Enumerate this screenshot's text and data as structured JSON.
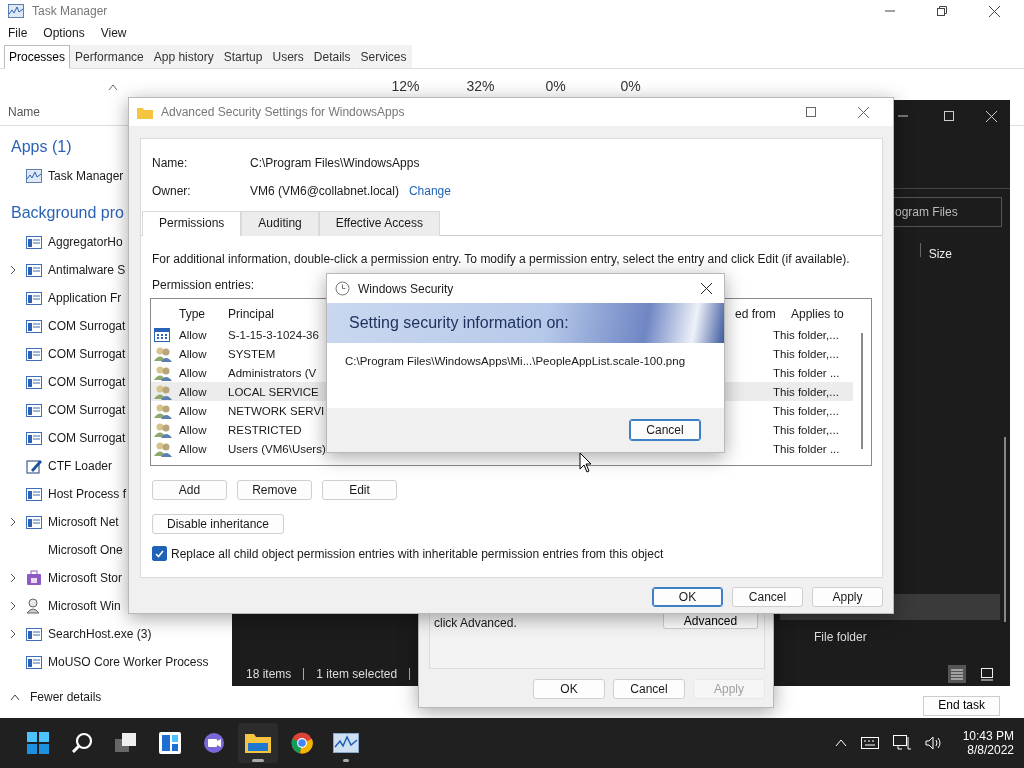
{
  "task_manager": {
    "title": "Task Manager",
    "menu": [
      "File",
      "Options",
      "View"
    ],
    "tabs": [
      {
        "label": "Processes",
        "selected": true
      },
      {
        "label": "Performance",
        "selected": false
      },
      {
        "label": "App history",
        "selected": false
      },
      {
        "label": "Startup",
        "selected": false
      },
      {
        "label": "Users",
        "selected": false
      },
      {
        "label": "Details",
        "selected": false
      },
      {
        "label": "Services",
        "selected": false
      }
    ],
    "usage": [
      "12%",
      "32%",
      "0%",
      "0%"
    ],
    "name_header": "Name",
    "groups": [
      {
        "label": "Apps (1)",
        "items": [
          {
            "name": "Task Manager",
            "kind": "chart",
            "expandable": false
          }
        ]
      },
      {
        "label": "Background pro",
        "items": [
          {
            "name": "AggregatorHo",
            "kind": "app",
            "expandable": false
          },
          {
            "name": "Antimalware S",
            "kind": "app",
            "expandable": true
          },
          {
            "name": "Application Fr",
            "kind": "app",
            "expandable": false
          },
          {
            "name": "COM Surrogat",
            "kind": "app",
            "expandable": false
          },
          {
            "name": "COM Surrogat",
            "kind": "app",
            "expandable": false
          },
          {
            "name": "COM Surrogat",
            "kind": "app",
            "expandable": false
          },
          {
            "name": "COM Surrogat",
            "kind": "app",
            "expandable": false
          },
          {
            "name": "COM Surrogat",
            "kind": "app",
            "expandable": false
          },
          {
            "name": "CTF Loader",
            "kind": "pen",
            "expandable": false
          },
          {
            "name": "Host Process f",
            "kind": "app",
            "expandable": false
          },
          {
            "name": "Microsoft Net",
            "kind": "app",
            "expandable": true
          },
          {
            "name": "Microsoft One",
            "kind": "blank",
            "expandable": false
          },
          {
            "name": "Microsoft Stor",
            "kind": "store",
            "expandable": true
          },
          {
            "name": "Microsoft Win",
            "kind": "person",
            "expandable": true
          },
          {
            "name": "SearchHost.exe (3)",
            "kind": "app",
            "expandable": true
          },
          {
            "name": "MoUSO Core Worker Process",
            "kind": "app",
            "expandable": false
          }
        ]
      }
    ],
    "fewer_details": "Fewer details",
    "end_task": "End task"
  },
  "explorer": {
    "search_text": "ogram Files",
    "size_header": "Size",
    "rows": [
      {
        "selected": true
      },
      {
        "type": "File folder",
        "selected": false
      }
    ],
    "status": [
      "18 items",
      "1 item selected"
    ],
    "views": [
      {
        "kind": "details",
        "selected": true
      },
      {
        "kind": "tiles",
        "selected": false
      }
    ]
  },
  "properties": {
    "text": "click Advanced.",
    "advanced": "Advanced",
    "buttons": [
      {
        "label": "OK",
        "disabled": false
      },
      {
        "label": "Cancel",
        "disabled": false
      },
      {
        "label": "Apply",
        "disabled": true
      }
    ]
  },
  "advanced_security": {
    "title": "Advanced Security Settings for WindowsApps",
    "name_label": "Name:",
    "name_value": "C:\\Program Files\\WindowsApps",
    "owner_label": "Owner:",
    "owner_value": "VM6 (VM6@collabnet.local)",
    "change_link": "Change",
    "tabs": [
      {
        "label": "Permissions",
        "selected": true
      },
      {
        "label": "Auditing",
        "selected": false
      },
      {
        "label": "Effective Access",
        "selected": false
      }
    ],
    "info": "For additional information, double-click a permission entry. To modify a permission entry, select the entry and click Edit (if available).",
    "entries_label": "Permission entries:",
    "columns": [
      "Type",
      "Principal",
      "ed from",
      "Applies to"
    ],
    "entries": [
      {
        "kind": "app",
        "type": "Allow",
        "principal": "S-1-15-3-1024-36",
        "applies_to": "This folder,...",
        "selected": false
      },
      {
        "kind": "group",
        "type": "Allow",
        "principal": "SYSTEM",
        "applies_to": "This folder,...",
        "selected": false
      },
      {
        "kind": "group",
        "type": "Allow",
        "principal": "Administrators (V",
        "applies_to": "This folder ...",
        "selected": false
      },
      {
        "kind": "group",
        "type": "Allow",
        "principal": "LOCAL SERVICE",
        "applies_to": "This folder,...",
        "selected": true
      },
      {
        "kind": "group",
        "type": "Allow",
        "principal": "NETWORK SERVI",
        "applies_to": "This folder,...",
        "selected": false
      },
      {
        "kind": "group",
        "type": "Allow",
        "principal": "RESTRICTED",
        "applies_to": "This folder,...",
        "selected": false
      },
      {
        "kind": "group",
        "type": "Allow",
        "principal": "Users (VM6\\Users)",
        "applies_to": "This folder ...",
        "selected": false
      }
    ],
    "entry_buttons": [
      "Add",
      "Remove",
      "Edit"
    ],
    "disable_inheritance": "Disable inheritance",
    "replace_option": {
      "label": "Replace all child object permission entries with inheritable permission entries from this object",
      "checked": true
    },
    "footer_buttons": [
      {
        "label": "OK",
        "default": true
      },
      {
        "label": "Cancel",
        "default": false
      },
      {
        "label": "Apply",
        "default": false
      }
    ]
  },
  "windows_security": {
    "title": "Windows Security",
    "heading": "Setting security information on:",
    "path": "C:\\Program Files\\WindowsApps\\Mi...\\PeopleAppList.scale-100.png",
    "cancel": "Cancel"
  },
  "taskbar": {
    "apps": [
      {
        "kind": "start",
        "running": false,
        "active": false
      },
      {
        "kind": "search",
        "running": false,
        "active": false
      },
      {
        "kind": "taskview",
        "running": false,
        "active": false
      },
      {
        "kind": "widgets",
        "running": false,
        "active": false
      },
      {
        "kind": "chat",
        "running": false,
        "active": false
      },
      {
        "kind": "folder",
        "running": true,
        "active": true
      },
      {
        "kind": "browser",
        "running": false,
        "active": false
      },
      {
        "kind": "chart",
        "running": true,
        "active": false
      }
    ],
    "time": "10:43 PM",
    "date": "8/8/2022"
  }
}
